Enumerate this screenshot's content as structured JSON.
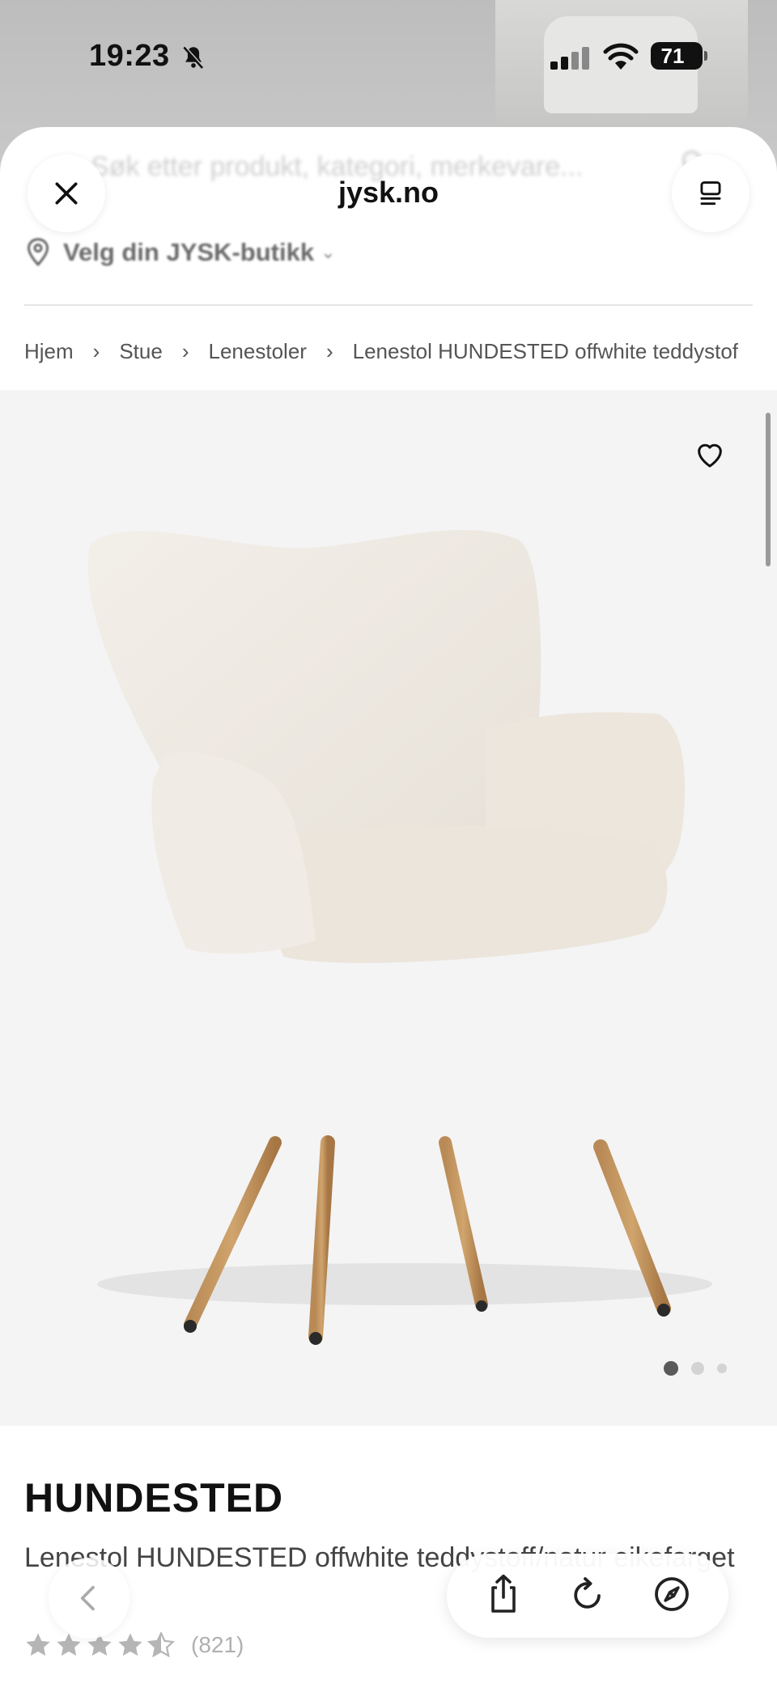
{
  "status_bar": {
    "time": "19:23",
    "battery": "71"
  },
  "browser": {
    "site": "jysk.no",
    "search_placeholder": "Søk etter produkt, kategori, merkevare..."
  },
  "store_selector": {
    "label": "Velg din JYSK-butikk",
    "chevron": "⌄"
  },
  "breadcrumb": {
    "items": [
      "Hjem",
      "Stue",
      "Lenestoler",
      "Lenestol HUNDESTED offwhite teddystof"
    ],
    "separator": "›"
  },
  "gallery": {
    "image_count": 3,
    "active_index": 0
  },
  "product": {
    "brand": "HUNDESTED",
    "description": "Lenestol HUNDESTED offwhite teddystoff/natur eikefarget",
    "rating": 4.5,
    "review_count": "(821)"
  },
  "icons": {
    "close": "close-icon",
    "reader": "reader-icon",
    "location": "location-pin-icon",
    "favorite": "heart-icon",
    "back": "chevron-left-icon",
    "share": "share-icon",
    "reload": "reload-icon",
    "compass": "compass-icon"
  },
  "colors": {
    "sheet_bg": "#ffffff",
    "gallery_bg": "#f4f4f4",
    "text_dark": "#111111",
    "star": "#b5b5b5"
  }
}
